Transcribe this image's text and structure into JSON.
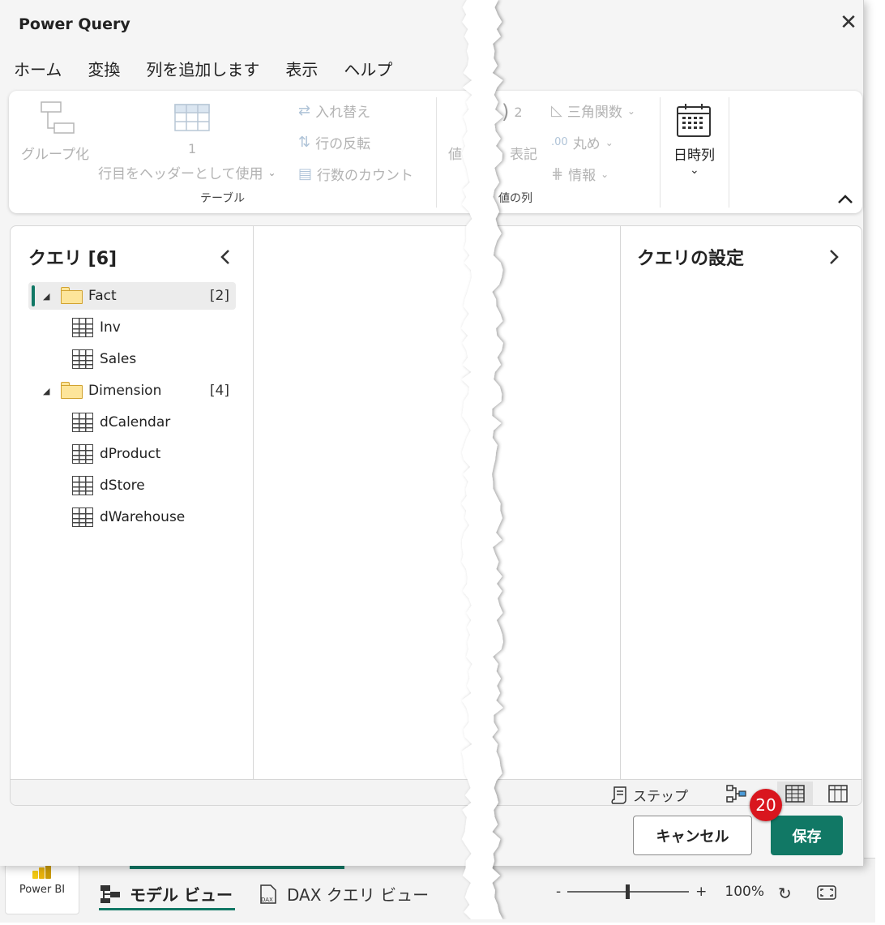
{
  "window": {
    "title": "Power Query",
    "close_label": "✕"
  },
  "tabs": [
    {
      "label": "ホーム"
    },
    {
      "label": "変換"
    },
    {
      "label": "列を追加します"
    },
    {
      "label": "表示"
    },
    {
      "label": "ヘルプ"
    }
  ],
  "active_tab": "変換",
  "ribbon": {
    "group_by": "グループ化",
    "use_first_row_line1": "1",
    "use_first_row_line2": "行目をヘッダーとして使用",
    "transpose": "入れ替え",
    "reverse_rows": "行の反転",
    "count_rows": "行数のカウント",
    "table_group_label": "テーブル",
    "value_partial": "値",
    "notation_partial": "表記",
    "power_symbol": "2",
    "trig": "三角関数",
    "rounding": "丸め",
    "information": "情報",
    "number_group_partial": "値の列",
    "datetime": "日時列",
    "collapse": "^"
  },
  "queries_pane": {
    "title": "クエリ [6]",
    "groups": [
      {
        "name": "Fact",
        "count": "[2]",
        "items": [
          "Inv",
          "Sales"
        ]
      },
      {
        "name": "Dimension",
        "count": "[4]",
        "items": [
          "dCalendar",
          "dProduct",
          "dStore",
          "dWarehouse"
        ]
      }
    ]
  },
  "settings_pane": {
    "title": "クエリの設定"
  },
  "status_bar": {
    "steps_label": "ステップ"
  },
  "footer": {
    "cancel_label": "キャンセル",
    "save_label": "保存",
    "badge_number": "20"
  },
  "background_app": {
    "app_name": "Power BI",
    "model_view": "モデル ビュー",
    "dax_view": "DAX クエリ ビュー",
    "dax_icon_text": "DAX",
    "zoom_minus": "-",
    "zoom_plus": "+",
    "zoom_level": "100%",
    "zoom_fraction": 0.5
  },
  "colors": {
    "accent": "#117865",
    "badge": "#d9161e",
    "folder": "#fde59a"
  }
}
